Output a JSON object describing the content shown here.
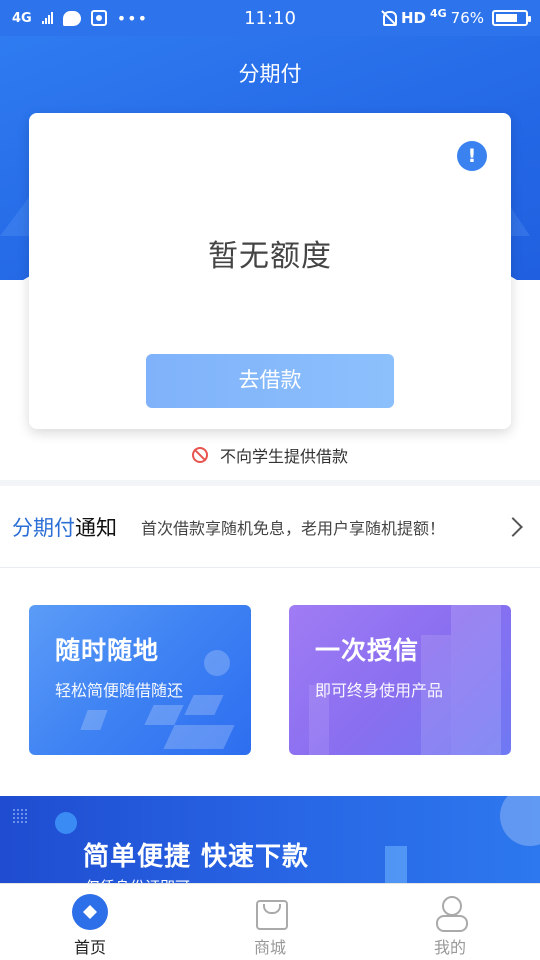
{
  "status_bar": {
    "network": "4G",
    "time": "11:10",
    "hd": "HD",
    "network_right": "4G",
    "battery_percent": "76%",
    "battery_level": 0.76,
    "icons": [
      "signal-icon",
      "chat-icon",
      "app-notification-icon",
      "more-dots-icon",
      "mute-icon",
      "battery-icon"
    ]
  },
  "header": {
    "title": "分期付"
  },
  "credit_card": {
    "status_text": "暂无额度",
    "borrow_button": "去借款",
    "info_icon": "!"
  },
  "student_notice": {
    "text": "不向学生提供借款",
    "icon": "ban-icon"
  },
  "notice": {
    "brand": "分期付",
    "brand_suffix": "通知",
    "message": "首次借款享随机免息，老用户享随机提额！",
    "icon": "chevron-right-icon"
  },
  "features": [
    {
      "title": "随时随地",
      "subtitle": "轻松简便随借随还"
    },
    {
      "title": "一次授信",
      "subtitle": "即可终身使用产品"
    }
  ],
  "promo": {
    "title": "简单便捷 快速下款",
    "subtitle": "仅凭身份证即可"
  },
  "bottom_nav": [
    {
      "label": "首页",
      "icon": "home-icon",
      "active": true
    },
    {
      "label": "商城",
      "icon": "shopping-bag-icon",
      "active": false
    },
    {
      "label": "我的",
      "icon": "profile-icon",
      "active": false
    }
  ],
  "colors": {
    "primary": "#2c73ec",
    "button": "#85b9fb",
    "brand_text": "#2b6fd6",
    "feature_blue": "#3e82f3",
    "feature_purple": "#8a6ff0",
    "warning": "#e8544f"
  }
}
